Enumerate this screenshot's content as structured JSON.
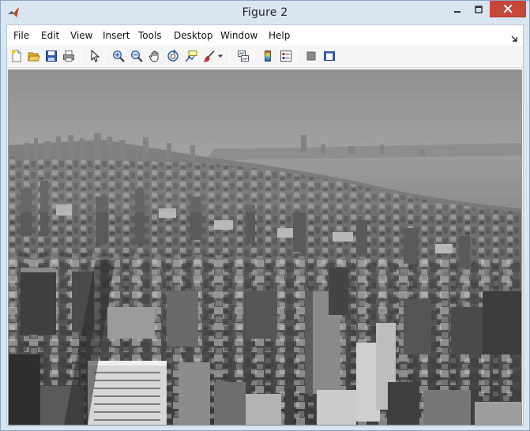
{
  "window": {
    "title": "Figure 2"
  },
  "menu": {
    "items": [
      "File",
      "Edit",
      "View",
      "Insert",
      "Tools",
      "Desktop",
      "Window",
      "Help"
    ]
  },
  "toolbar": {
    "buttons": [
      {
        "name": "new-figure-icon"
      },
      {
        "name": "open-file-icon"
      },
      {
        "name": "save-figure-icon"
      },
      {
        "name": "print-figure-icon"
      },
      {
        "name": "edit-plot-arrow-icon"
      },
      {
        "name": "zoom-in-icon"
      },
      {
        "name": "zoom-out-icon"
      },
      {
        "name": "pan-hand-icon"
      },
      {
        "name": "rotate-3d-icon"
      },
      {
        "name": "data-cursor-icon"
      },
      {
        "name": "brush-icon"
      },
      {
        "name": "brush-dropdown-icon"
      },
      {
        "name": "link-plot-icon"
      },
      {
        "name": "insert-colorbar-icon"
      },
      {
        "name": "insert-legend-icon"
      },
      {
        "name": "hide-plot-tools-icon"
      },
      {
        "name": "show-plot-tools-icon"
      }
    ]
  },
  "colors": {
    "titlebar": "#dae5f2",
    "close_button": "#c7463a",
    "menubar": "#ffffff",
    "toolbar": "#f5f5f5"
  },
  "figure": {
    "content": "grayscale-cityscape-photo"
  }
}
